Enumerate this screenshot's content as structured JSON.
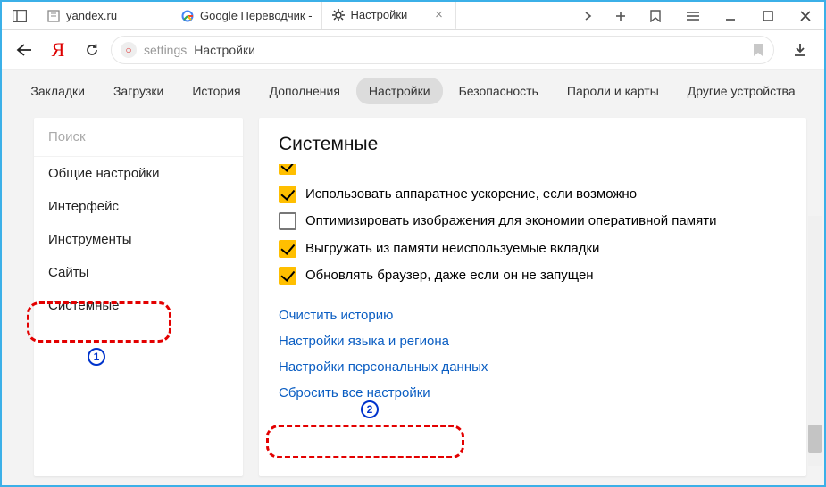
{
  "titlebar": {
    "tabs": [
      {
        "label": "yandex.ru",
        "favicon": "page"
      },
      {
        "label": "Google Переводчик -",
        "favicon": "google"
      },
      {
        "label": "Настройки",
        "favicon": "gear",
        "active": true
      }
    ]
  },
  "address": {
    "path": "settings",
    "title": "Настройки"
  },
  "toptabs": {
    "items": [
      "Закладки",
      "Загрузки",
      "История",
      "Дополнения",
      "Настройки",
      "Безопасность",
      "Пароли и карты",
      "Другие устройства"
    ],
    "active": "Настройки"
  },
  "sidebar": {
    "search_placeholder": "Поиск",
    "items": [
      "Общие настройки",
      "Интерфейс",
      "Инструменты",
      "Сайты",
      "Системные"
    ],
    "active": "Системные"
  },
  "settings": {
    "section_title": "Системные",
    "checkboxes": [
      {
        "checked": true,
        "label": "Использовать аппаратное ускорение, если возможно"
      },
      {
        "checked": false,
        "label": "Оптимизировать изображения для экономии оперативной памяти"
      },
      {
        "checked": true,
        "label": "Выгружать из памяти неиспользуемые вкладки"
      },
      {
        "checked": true,
        "label": "Обновлять браузер, даже если он не запущен"
      }
    ],
    "links": [
      "Очистить историю",
      "Настройки языка и региона",
      "Настройки персональных данных",
      "Сбросить все настройки"
    ]
  },
  "callouts": {
    "n1": "1",
    "n2": "2"
  }
}
